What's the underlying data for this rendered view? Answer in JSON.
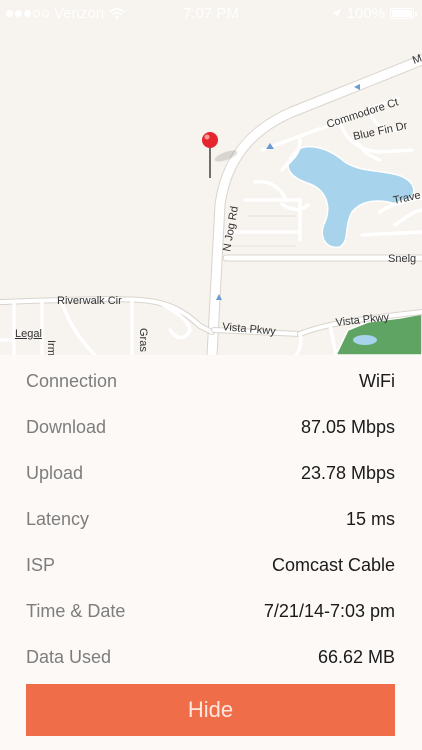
{
  "status_bar": {
    "carrier": "Verizon",
    "time": "7:07 PM",
    "battery": "100%",
    "battery_level": 1.0,
    "signal_bars": 3,
    "icons": [
      "wifi-icon",
      "location-arrow-icon",
      "battery-icon"
    ]
  },
  "map": {
    "legal": "Legal",
    "streets": {
      "n_jog_rd": "N Jog Rd",
      "commodore_ct": "Commodore Ct",
      "blue_fin_dr": "Blue Fin Dr",
      "trave": "Trave",
      "snelg": "Snelg",
      "riverwalk_cir": "Riverwalk Cir",
      "vista_pkwy_left": "Vista Pkwy",
      "vista_pkwy_right": "Vista Pkwy",
      "grass": "Gras",
      "irm": "Irm",
      "m": "M"
    },
    "pin_icon": "map-pin-icon",
    "colors": {
      "land": "#f7f3ee",
      "water": "#a7d4ec",
      "park": "#5fa463",
      "road": "#ffffff"
    }
  },
  "details": [
    {
      "label": "Connection",
      "value": "WiFi"
    },
    {
      "label": "Download",
      "value": "87.05 Mbps"
    },
    {
      "label": "Upload",
      "value": "23.78 Mbps"
    },
    {
      "label": "Latency",
      "value": "15 ms"
    },
    {
      "label": "ISP",
      "value": "Comcast Cable"
    },
    {
      "label": "Time & Date",
      "value": "7/21/14-7:03 pm"
    },
    {
      "label": "Data Used",
      "value": "66.62 MB"
    }
  ],
  "hide_button": {
    "label": "Hide",
    "color": "#ef6d48"
  }
}
